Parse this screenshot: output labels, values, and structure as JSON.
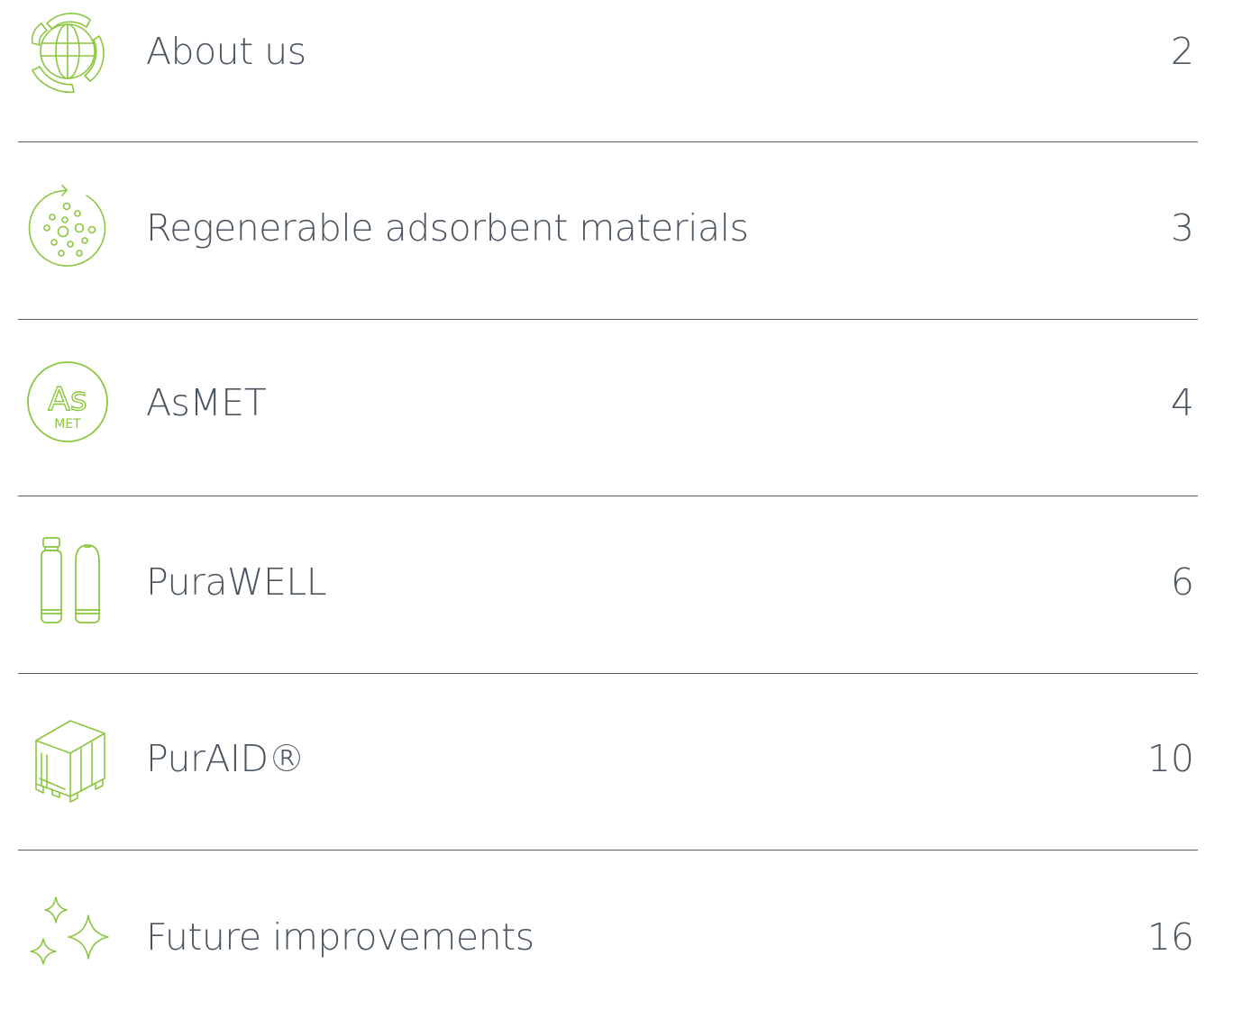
{
  "colors": {
    "icon_green": "#8cc63f",
    "text": "#4b5560",
    "divider": "#56606a"
  },
  "toc": {
    "entries": [
      {
        "icon": "recycle-globe-icon",
        "title": "About us",
        "page": "2"
      },
      {
        "icon": "adsorbent-beads-icon",
        "title": "Regenerable adsorbent materials",
        "page": "3"
      },
      {
        "icon": "asmet-badge-icon",
        "title": "AsMET",
        "page": "4",
        "icon_text_main": "As",
        "icon_text_sub": "MET"
      },
      {
        "icon": "filter-cylinders-icon",
        "title": "PuraWELL",
        "page": "6"
      },
      {
        "icon": "container-unit-icon",
        "title": "PurAID®",
        "page": "10"
      },
      {
        "icon": "sparkles-icon",
        "title": "Future improvements",
        "page": "16"
      }
    ]
  }
}
